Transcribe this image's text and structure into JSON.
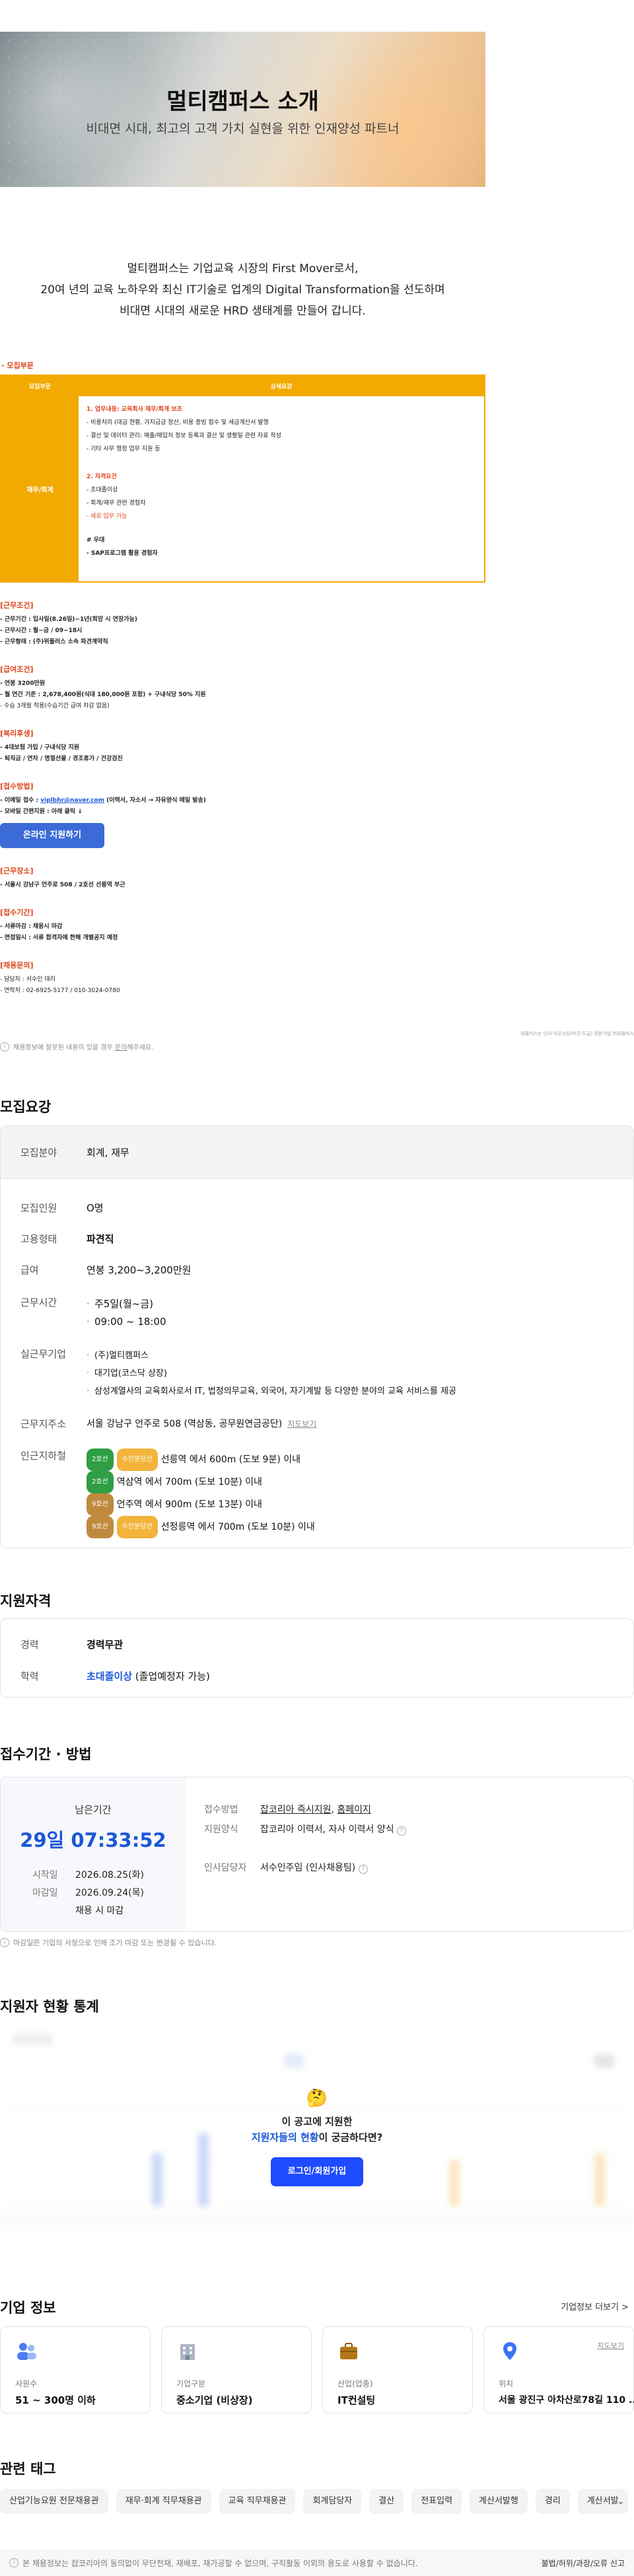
{
  "banner": {
    "title": "멀티캠퍼스 소개",
    "subtitle": "비대면 시대, 최고의 고객 가치 실현을 위한 인재양성 파트너"
  },
  "intro": {
    "lines": [
      "멀티캠퍼스는 기업교육 시장의 First Mover로서,",
      "20여 년의 교육 노하우와 최신 IT기술로 업계의 Digital Transformation을 선도하며",
      "비대면 시대의 새로운 HRD 생태계를 만들어 갑니다."
    ]
  },
  "posting": {
    "section_label": "- 모집부문",
    "col1": "모집부문",
    "col2": "상세요강",
    "dept": "재무/회계",
    "duty_title": "1. 업무내용: 교육회사 재무/회계 보조",
    "duties": [
      "- 비용처리 (대금 현황, 가지급금 정산, 비용 증빙 접수 및 세금계산서 발행",
      "- 결산 및 데이터 관리: 매출/매입처 정보 등록과 결산 및 생활일 관련 자료 작성",
      "- 기타 사무 행정 업무 지원 등"
    ],
    "qual_title": "2. 자격요건",
    "quals": [
      "- 초대졸이상",
      "- 회계/재무 관련 경험자",
      "- 세로 업무 가능"
    ],
    "pref_title": "# 우대",
    "prefs": [
      "- SAP프로그램 활용 경험자"
    ]
  },
  "conditions": {
    "title": "[근무조건]",
    "lines": [
      "- 근무기간 : 입사일(8.26일)~1년(희망 시 연장가능)",
      "- 근무시간 : 월~금 / 09~18시",
      "- 근무형태 : (주)위플러스 소속 파견계약직"
    ]
  },
  "salary": {
    "title": "[급여조건]",
    "lines": [
      "- 연봉 3200만원",
      "- 월 연간 기준 : 2,678,400원(식대 180,000원 포함) + 구내식당 50% 지원",
      "- 수습 3개월 적용(수습기간 급여 차감 없음)"
    ]
  },
  "welfare": {
    "title": "[복리후생]",
    "lines": [
      "- 4대보험 가입 / 구내식당 지원",
      "- 퇴직금 / 연차 / 명절선물 / 경조휴가 / 건강검진"
    ]
  },
  "apply": {
    "title": "[접수방법]",
    "email_prefix": "- 이메일 접수 : ",
    "email": "viplbhr@naver.com",
    "email_suffix": " (이력서, 자소서 → 자유양식 메일 발송)",
    "mobile": "- 모바일 간편지원 : 아래 클릭 ↓",
    "button": "온라인 지원하기"
  },
  "location": {
    "title": "[근무장소]",
    "line": "- 서울시 강남구 언주로 508 / 2호선 선릉역 부근"
  },
  "process": {
    "title": "[접수기간]",
    "lines": [
      "- 서류마감 : 채용시 마감",
      "- 면접일시 : 서류 합격자에 한해 개별공지 예정"
    ]
  },
  "contact": {
    "title": "[채용문의]",
    "lines": [
      "- 담당자 : 서수인 대리",
      "- 연락처 : 02-6925-5177 / 010-3024-0780"
    ]
  },
  "right_note": "위플러스는 인사 아웃소싱(파견·도급) 전문기업 ㈜위플러스",
  "notice_info": {
    "text_prefix": "채용정보에 잘못된 내용이 있을 경우 ",
    "link": "문의",
    "text_suffix": "해주세요."
  },
  "requirements": {
    "section_title": "모집요강",
    "field_label": "모집분야",
    "field_value": "회계, 재무",
    "rows": {
      "count_label": "모집인원",
      "count_value": "O명",
      "type_label": "고용형태",
      "type_value": "파견직",
      "pay_label": "급여",
      "pay_value": "연봉 3,200~3,200만원",
      "time_label": "근무시간",
      "time_values": [
        "주5일(월~금)",
        "09:00 ~ 18:00"
      ],
      "company_label": "실근무기업",
      "company_values": [
        "(주)멀티캠퍼스",
        "대기업(코스닥 상장)",
        "삼성계열사의 교육회사로서 IT, 법정의무교육, 외국어, 자기계발 등 다양한 분야의 교육 서비스를 제공"
      ],
      "address_label": "근무지주소",
      "address_value": "서울 강남구 언주로 508 (역삼동, 공무원연금공단)",
      "map_link": "지도보기",
      "subway_label": "인근지하철",
      "subways": [
        {
          "badges": [
            "2호선",
            "수인분당선"
          ],
          "text": "선릉역 에서 600m (도보 9분) 이내"
        },
        {
          "badges": [
            "2호선"
          ],
          "text": "역삼역 에서 700m (도보 10분) 이내"
        },
        {
          "badges": [
            "9호선"
          ],
          "text": "언주역 에서 900m (도보 13분) 이내"
        },
        {
          "badges": [
            "9호선",
            "수인분당선"
          ],
          "text": "선정릉역 에서 700m (도보 10분) 이내"
        }
      ]
    }
  },
  "qualification": {
    "section_title": "지원자격",
    "career_label": "경력",
    "career_value": "경력무관",
    "edu_label": "학력",
    "edu_value": "초대졸이상",
    "edu_suffix": " (졸업예정자 가능)"
  },
  "period": {
    "section_title": "접수기간 · 방법",
    "remaining_label": "남은기간",
    "remaining": "29일 07:33:52",
    "start_label": "시작일",
    "start": "2026.08.25(화)",
    "end_label": "마감일",
    "end": "2026.09.24(목)",
    "end_note": "채용 시 마감",
    "method_label": "접수방법",
    "method_value1": "잡코리아 즉시지원",
    "method_value2": "홈페이지",
    "form_label": "지원양식",
    "form_value": "잡코리아 이력서, 자사 이력서 양식",
    "manager_label": "인사담당자",
    "manager_value": "서수인주임 (인사채용팀)",
    "note": "마감일은 기업의 사정으로 인해 조기 마감 또는 변경될 수 있습니다."
  },
  "stats": {
    "section_title": "지원자 현황 통계",
    "emoji": "🤔",
    "line1": "이 공고에 지원한",
    "line2_highlight": "지원자들의 현황",
    "line2_rest": "이 궁금하다면?",
    "button": "로그인/회원가입"
  },
  "company": {
    "section_title": "기업 정보",
    "more_link": "기업정보 더보기 >",
    "cards": [
      {
        "label": "사원수",
        "value": "51 ~ 300명 이하",
        "icon": "people-icon"
      },
      {
        "label": "기업구분",
        "value": "중소기업 (비상장)",
        "icon": "building-icon"
      },
      {
        "label": "산업(업종)",
        "value": "IT컨설팅",
        "icon": "briefcase-icon"
      },
      {
        "label": "위치",
        "value": "서울 광진구 아차산로78길 110 ...",
        "icon": "location-pin-icon",
        "link": "지도보기"
      }
    ]
  },
  "tags": {
    "section_title": "관련 태그",
    "items": [
      "산업기능요원 전문채용관",
      "재무·회계 직무채용관",
      "교육 직무채용관",
      "회계담당자",
      "결산",
      "전표입력",
      "계산서발행",
      "경리",
      "계산서발"
    ]
  },
  "footer": {
    "text": "본 채용정보는 잡코리아의 동의없이 무단전재, 재배포, 재가공할 수 없으며, 구직활동 이외의 용도로 사용할 수 없습니다.",
    "report": "불법/허위/과장/오류 신고"
  },
  "colors": {
    "accent": "#f2a900",
    "primary": "#1b57d8",
    "warn": "#e0441b"
  }
}
